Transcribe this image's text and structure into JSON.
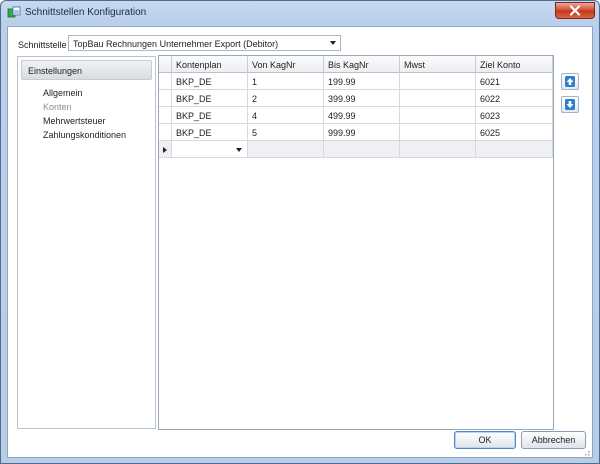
{
  "window": {
    "title": "Schnittstellen Konfiguration"
  },
  "interface": {
    "label": "Schnittstelle",
    "selected": "TopBau Rechnungen Unternehmer Export (Debitor)"
  },
  "nav": {
    "header": "Einstellungen",
    "items": [
      {
        "label": "Allgemein",
        "active": false
      },
      {
        "label": "Konten",
        "active": true
      },
      {
        "label": "Mehrwertsteuer",
        "active": false
      },
      {
        "label": "Zahlungskonditionen",
        "active": false
      }
    ]
  },
  "grid": {
    "columns": [
      "Kontenplan",
      "Von KagNr",
      "Bis KagNr",
      "Mwst",
      "Ziel Konto"
    ],
    "rows": [
      [
        "BKP_DE",
        "1",
        "199.99",
        "",
        "6021"
      ],
      [
        "BKP_DE",
        "2",
        "399.99",
        "",
        "6022"
      ],
      [
        "BKP_DE",
        "4",
        "499.99",
        "",
        "6023"
      ],
      [
        "BKP_DE",
        "5",
        "999.99",
        "",
        "6025"
      ]
    ]
  },
  "side_buttons": {
    "up_icon": "arrow-up-icon",
    "down_icon": "arrow-down-icon"
  },
  "buttons": {
    "ok": "OK",
    "cancel": "Abbrechen"
  },
  "colors": {
    "title_bar": "#b9cfea",
    "close_button": "#d2472b",
    "accent_arrow": "#2f7fd0"
  }
}
